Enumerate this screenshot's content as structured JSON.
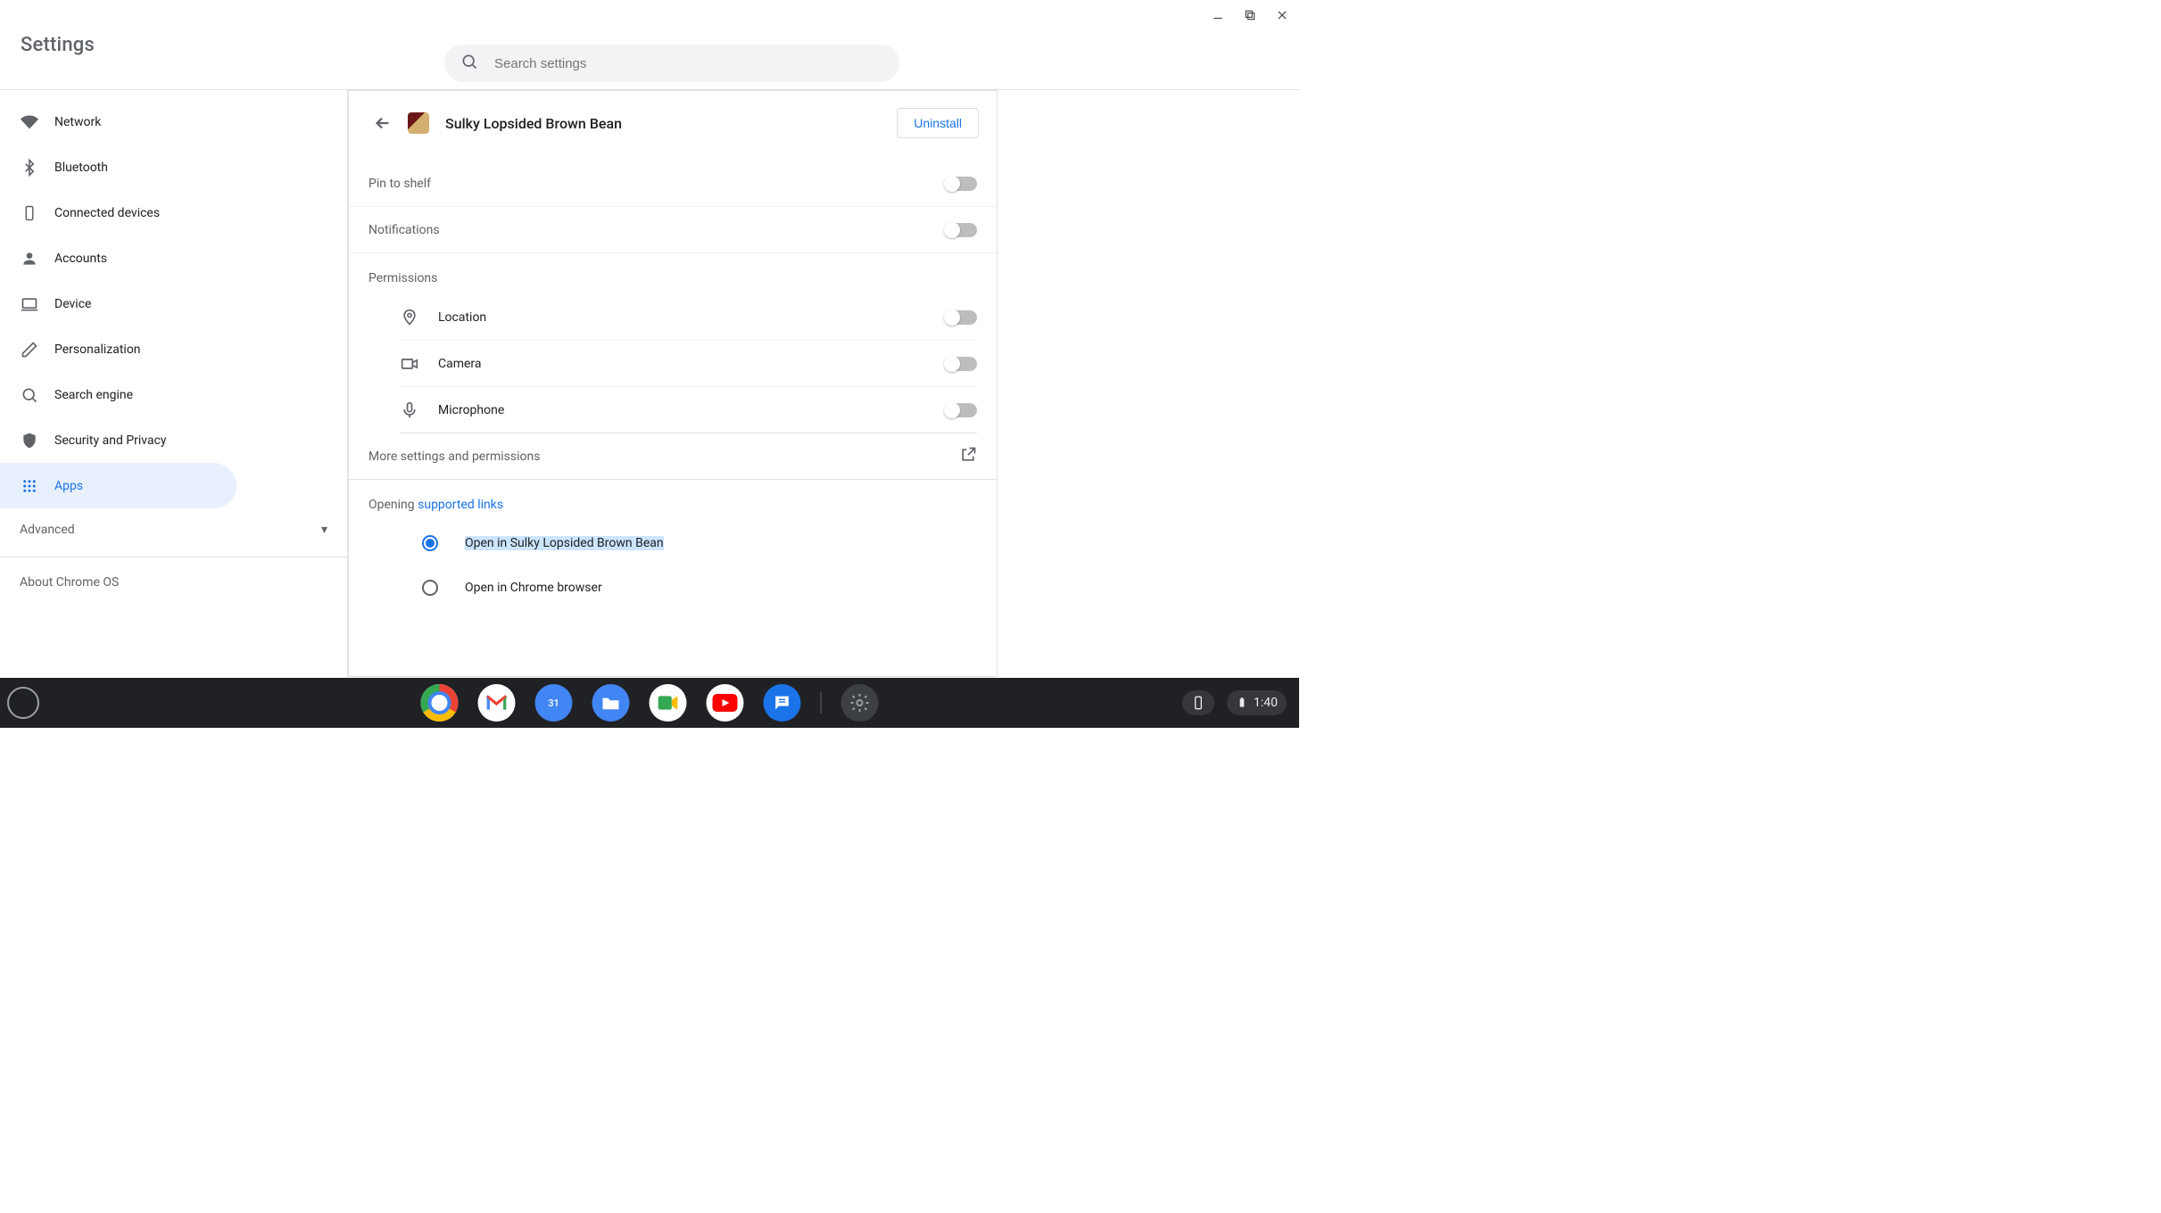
{
  "window": {
    "title": "Settings"
  },
  "search": {
    "placeholder": "Search settings"
  },
  "sidebar": {
    "items": [
      {
        "label": "Network"
      },
      {
        "label": "Bluetooth"
      },
      {
        "label": "Connected devices"
      },
      {
        "label": "Accounts"
      },
      {
        "label": "Device"
      },
      {
        "label": "Personalization"
      },
      {
        "label": "Search engine"
      },
      {
        "label": "Security and Privacy"
      },
      {
        "label": "Apps"
      }
    ],
    "advanced": "Advanced",
    "about": "About Chrome OS"
  },
  "main": {
    "app_name": "Sulky Lopsided Brown Bean",
    "uninstall": "Uninstall",
    "pin_to_shelf": "Pin to shelf",
    "notifications": "Notifications",
    "permissions_title": "Permissions",
    "permissions": {
      "location": "Location",
      "camera": "Camera",
      "microphone": "Microphone"
    },
    "more_settings": "More settings and permissions",
    "opening_prefix": "Opening ",
    "opening_link": "supported links",
    "radio_open_in_app": "Open in Sulky Lopsided Brown Bean",
    "radio_open_in_chrome": "Open in Chrome browser"
  },
  "shelf": {
    "time": "1:40",
    "apps": [
      "Chrome",
      "Gmail",
      "Calendar",
      "Files",
      "Meet",
      "YouTube",
      "Messages",
      "Settings"
    ]
  }
}
